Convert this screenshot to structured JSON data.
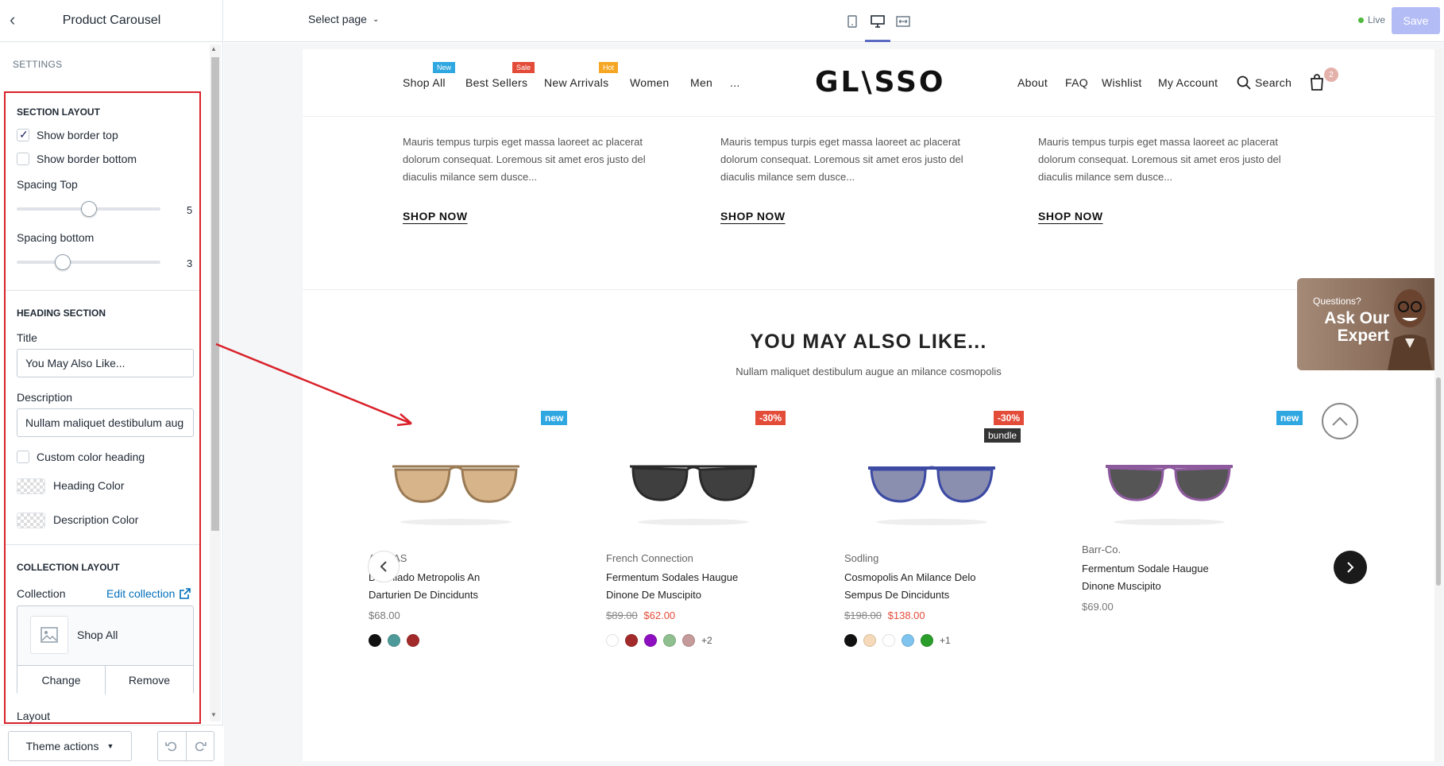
{
  "sidebar": {
    "title": "Product Carousel",
    "settings_label": "SETTINGS",
    "section_layout": {
      "heading": "SECTION LAYOUT",
      "show_border_top": "Show border top",
      "show_border_top_checked": true,
      "show_border_bottom": "Show border bottom",
      "show_border_bottom_checked": false,
      "spacing_top_label": "Spacing Top",
      "spacing_top_value": "5",
      "spacing_bottom_label": "Spacing bottom",
      "spacing_bottom_value": "3"
    },
    "heading_section": {
      "heading": "HEADING SECTION",
      "title_label": "Title",
      "title_value": "You May Also Like...",
      "description_label": "Description",
      "description_value": "Nullam maliquet destibulum aug",
      "custom_color_label": "Custom color heading",
      "custom_color_checked": false,
      "heading_color_label": "Heading Color",
      "description_color_label": "Description Color"
    },
    "collection_layout": {
      "heading": "COLLECTION LAYOUT",
      "collection_label": "Collection",
      "edit_collection": "Edit collection",
      "collection_name": "Shop All",
      "change_label": "Change",
      "remove_label": "Remove",
      "layout_label": "Layout"
    },
    "footer": {
      "theme_actions": "Theme actions"
    }
  },
  "topbar": {
    "select_page": "Select page",
    "live_label": "Live",
    "save_label": "Save"
  },
  "store": {
    "nav_left": [
      {
        "label": "Shop All",
        "badge": "New",
        "badge_color": "#2fa7e0"
      },
      {
        "label": "Best Sellers",
        "badge": "Sale",
        "badge_color": "#e44c3a"
      },
      {
        "label": "New Arrivals",
        "badge": "Hot",
        "badge_color": "#f5a623"
      },
      {
        "label": "Women",
        "badge": "",
        "badge_color": ""
      },
      {
        "label": "Men",
        "badge": "",
        "badge_color": ""
      },
      {
        "label": "...",
        "badge": "",
        "badge_color": ""
      }
    ],
    "logo": "GL\\SSO",
    "nav_right": [
      "About",
      "FAQ",
      "Wishlist",
      "My Account",
      "Search"
    ],
    "cart_count": "2",
    "promo_text": "Mauris tempus turpis eget massa laoreet ac placerat dolorum consequat. Loremous sit amet eros justo del diaculis milance sem dusce...",
    "shop_now": "SHOP NOW",
    "heading": "YOU MAY ALSO LIKE...",
    "subheading": "Nullam maliquet destibulum augue an milance cosmopolis",
    "expert_question": "Questions?",
    "expert_title": "Ask Our Expert",
    "products": [
      {
        "badge": "new",
        "badge_color": "#2fa7e0",
        "badge2": "",
        "brand": "ADIDAS",
        "name": "Daciniado Metropolis An Darturien De Dincidunts",
        "price_old": "",
        "price": "$68.00",
        "colors": [
          "#111111",
          "#4e9a9a",
          "#a32a2a"
        ],
        "more": "",
        "lens": "#d8b48a",
        "frame": "#9a7b55"
      },
      {
        "badge": "-30%",
        "badge_color": "#e44c3a",
        "badge2": "",
        "brand": "French Connection",
        "name": "Fermentum Sodales Haugue Dinone De Muscipito",
        "price_old": "$89.00",
        "price": "$62.00",
        "colors": [
          "#ffffff",
          "#a32a2a",
          "#8e0fbf",
          "#8fbf8f",
          "#c49a9a"
        ],
        "more": "+2",
        "lens": "#3f3f3f",
        "frame": "#2a2a2a"
      },
      {
        "badge": "-30%",
        "badge_color": "#e44c3a",
        "badge2": "bundle",
        "brand": "Sodling",
        "name": "Cosmopolis An Milance Delo Sempus De Dincidunts",
        "price_old": "$198.00",
        "price": "$138.00",
        "colors": [
          "#111111",
          "#f5d9b8",
          "#ffffff",
          "#7fc4ef",
          "#2a9d2a"
        ],
        "more": "+1",
        "lens": "#8a8fb0",
        "frame": "#3c4aa3"
      },
      {
        "badge": "new",
        "badge_color": "#2fa7e0",
        "badge2": "",
        "brand": "Barr-Co.",
        "name": "Fermentum Sodale Haugue Dinone Muscipito",
        "price_old": "",
        "price": "$69.00",
        "colors": [],
        "more": "",
        "lens": "#555555",
        "frame": "#8e5a9e"
      }
    ]
  },
  "colors": {
    "annotation_red": "#d9212a",
    "accent": "#5c6ac4",
    "link": "#006fbb"
  }
}
